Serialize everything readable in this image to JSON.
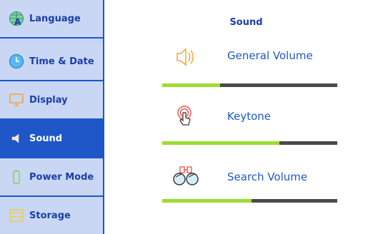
{
  "sidebar": {
    "items": [
      {
        "label": "Language",
        "icon": "language-icon",
        "active": false
      },
      {
        "label": "Time & Date",
        "icon": "clock-icon",
        "active": false
      },
      {
        "label": "Display",
        "icon": "monitor-icon",
        "active": false
      },
      {
        "label": "Sound",
        "icon": "speaker-icon",
        "active": true
      },
      {
        "label": "Power Mode",
        "icon": "battery-icon",
        "active": false
      },
      {
        "label": "Storage",
        "icon": "storage-icon",
        "active": false
      }
    ]
  },
  "main": {
    "title": "Sound",
    "settings": [
      {
        "label": "General Volume",
        "icon": "speaker-volume-icon",
        "level": 0.33
      },
      {
        "label": "Keytone",
        "icon": "touch-icon",
        "level": 0.67
      },
      {
        "label": "Search Volume",
        "icon": "binoculars-icon",
        "level": 0.51
      }
    ]
  },
  "colors": {
    "accent": "#1f57c8",
    "sidebar_bg": "#c9d7f5",
    "slider_fill": "#9ddc33",
    "slider_track": "#4b4b4b"
  }
}
